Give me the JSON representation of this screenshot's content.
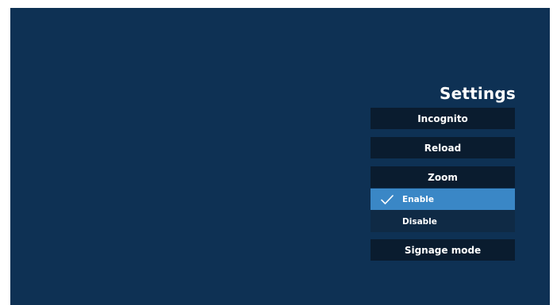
{
  "settings": {
    "title": "Settings",
    "items": {
      "incognito": "Incognito",
      "reload": "Reload",
      "zoom": "Zoom",
      "signage_mode": "Signage mode"
    },
    "zoom_options": [
      {
        "label": "Enable",
        "selected": true,
        "icon": "checkmark-icon"
      },
      {
        "label": "Disable",
        "selected": false
      }
    ]
  },
  "colors": {
    "background": "#0e3154",
    "button": "#0a1c2f",
    "selected_highlight": "#3a87c6",
    "text": "#ffffff"
  }
}
